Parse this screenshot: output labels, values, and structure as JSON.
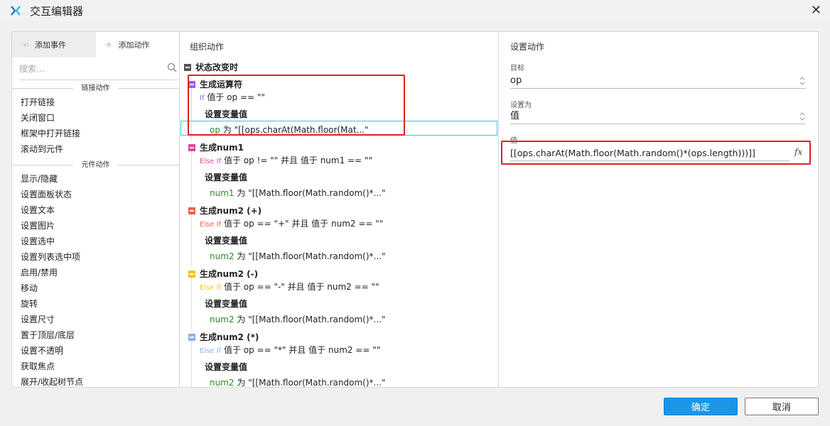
{
  "window": {
    "title": "交互编辑器"
  },
  "colors": {
    "accent": "#1a95e8",
    "highlight_red": "#e02020",
    "highlight_cyan": "#35c9d2"
  },
  "left": {
    "tabs": [
      {
        "label": "添加事件",
        "icon": "pointer-event-icon"
      },
      {
        "label": "添加动作",
        "icon": "sparkle-action-icon"
      }
    ],
    "search_placeholder": "搜索...",
    "group_link": "链接动作",
    "link_items": [
      "打开链接",
      "关闭窗口",
      "框架中打开链接",
      "滚动到元件"
    ],
    "group_widget": "元件动作",
    "widget_items": [
      "显示/隐藏",
      "设置面板状态",
      "设置文本",
      "设置图片",
      "设置选中",
      "设置列表选中项",
      "启用/禁用",
      "移动",
      "旋转",
      "设置尺寸",
      "置于顶层/底层",
      "设置不透明",
      "获取焦点",
      "展开/收起树节点"
    ]
  },
  "middle": {
    "header": "组织动作",
    "event": "状态改变时",
    "cases": [
      {
        "name": "生成运算符",
        "color": "#a259f7",
        "cond_kw": "If",
        "cond_kw_color": "#a259f7",
        "cond": "值于 op == \"\"",
        "action": "设置变量值",
        "var": "op",
        "wei": "为",
        "val": "\"[[ops.charAt(Math.floor(Mat...\""
      },
      {
        "name": "生成num1",
        "color": "#e0479e",
        "cond_kw": "Else If",
        "cond_kw_color": "#e0479e",
        "cond": "值于 op != \"\" 并且 值于 num1 == \"\"",
        "action": "设置变量值",
        "var": "num1",
        "wei": "为",
        "val": "\"[[Math.floor(Math.random()*...\""
      },
      {
        "name": "生成num2 (+)",
        "color": "#f0624d",
        "cond_kw": "Else If",
        "cond_kw_color": "#f0624d",
        "cond": "值于 op == \"+\" 并且 值于 num2 == \"\"",
        "action": "设置变量值",
        "var": "num2",
        "wei": "为",
        "val": "\"[[Math.floor(Math.random()*...\""
      },
      {
        "name": "生成num2 (-)",
        "color": "#f5c518",
        "cond_kw": "Else If",
        "cond_kw_color": "#f5c518",
        "cond": "值于 op == \"-\" 并且 值于 num2 == \"\"",
        "action": "设置变量值",
        "var": "num2",
        "wei": "为",
        "val": "\"[[Math.floor(Math.random()*...\""
      },
      {
        "name": "生成num2 (*)",
        "color": "#8ab4e8",
        "cond_kw": "Else If",
        "cond_kw_color": "#8ab4e8",
        "cond": "值于 op == \"*\" 并且 值于 num2 == \"\"",
        "action": "设置变量值",
        "var": "num2",
        "wei": "为",
        "val": "\"[[Math.floor(Math.random()*...\""
      }
    ]
  },
  "right": {
    "header": "设置动作",
    "target_label": "目标",
    "target_value": "op",
    "setas_label": "设置为",
    "setas_value": "值",
    "value_label": "值",
    "value_value": "[[ops.charAt(Math.floor(Math.random()*(ops.length)))]]",
    "fx_label": "fx"
  },
  "buttons": {
    "ok": "确定",
    "cancel": "取消"
  }
}
